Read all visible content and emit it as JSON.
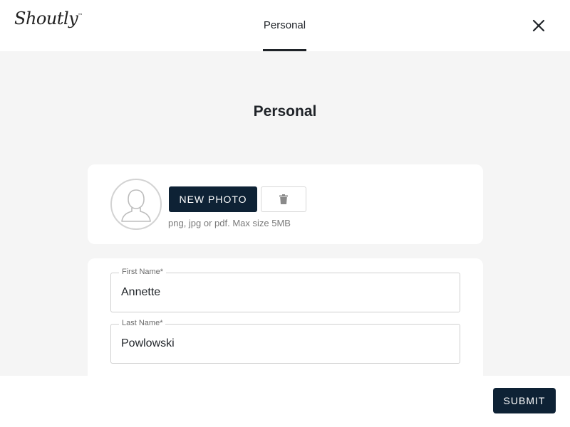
{
  "header": {
    "logo_text": "Shoutly",
    "logo_mark": "™",
    "tab_label": "Personal",
    "close_icon": "close-icon"
  },
  "page": {
    "title": "Personal"
  },
  "photo": {
    "avatar_icon": "person-silhouette-icon",
    "new_photo_label": "NEW PHOTO",
    "delete_icon": "trash-icon",
    "hint": "png, jpg or pdf. Max size 5MB"
  },
  "form": {
    "first_name": {
      "label": "First Name*",
      "value": "Annette"
    },
    "last_name": {
      "label": "Last Name*",
      "value": "Powlowski"
    }
  },
  "footer": {
    "submit_label": "SUBMIT"
  },
  "colors": {
    "primary": "#0e2235",
    "background": "#f5f5f5",
    "card": "#ffffff"
  }
}
